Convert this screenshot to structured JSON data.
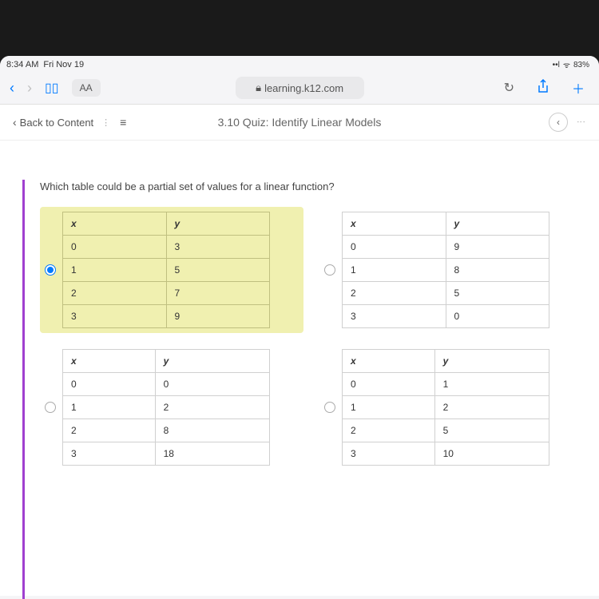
{
  "status": {
    "time": "8:34 AM",
    "date": "Fri Nov 19",
    "signal": "••l",
    "wifi": "◈",
    "battery": "83%"
  },
  "browser": {
    "aa": "AA",
    "lock": "🔒",
    "url": "learning.k12.com",
    "refresh": "↻",
    "share": "⤴",
    "plus": "＋"
  },
  "page": {
    "back_label": "Back to Content",
    "back_chev": "‹",
    "hamburger": "≡",
    "title": "3.10 Quiz: Identify Linear Models",
    "circle_icon": "‹"
  },
  "question": {
    "text": "Which table could be a partial set of values for a linear function?"
  },
  "options": [
    {
      "selected": true,
      "headers": [
        "x",
        "y"
      ],
      "rows": [
        [
          "0",
          "3"
        ],
        [
          "1",
          "5"
        ],
        [
          "2",
          "7"
        ],
        [
          "3",
          "9"
        ]
      ]
    },
    {
      "selected": false,
      "headers": [
        "x",
        "y"
      ],
      "rows": [
        [
          "0",
          "9"
        ],
        [
          "1",
          "8"
        ],
        [
          "2",
          "5"
        ],
        [
          "3",
          "0"
        ]
      ]
    },
    {
      "selected": false,
      "headers": [
        "x",
        "y"
      ],
      "rows": [
        [
          "0",
          "0"
        ],
        [
          "1",
          "2"
        ],
        [
          "2",
          "8"
        ],
        [
          "3",
          "18"
        ]
      ]
    },
    {
      "selected": false,
      "headers": [
        "x",
        "y"
      ],
      "rows": [
        [
          "0",
          "1"
        ],
        [
          "1",
          "2"
        ],
        [
          "2",
          "5"
        ],
        [
          "3",
          "10"
        ]
      ]
    }
  ]
}
